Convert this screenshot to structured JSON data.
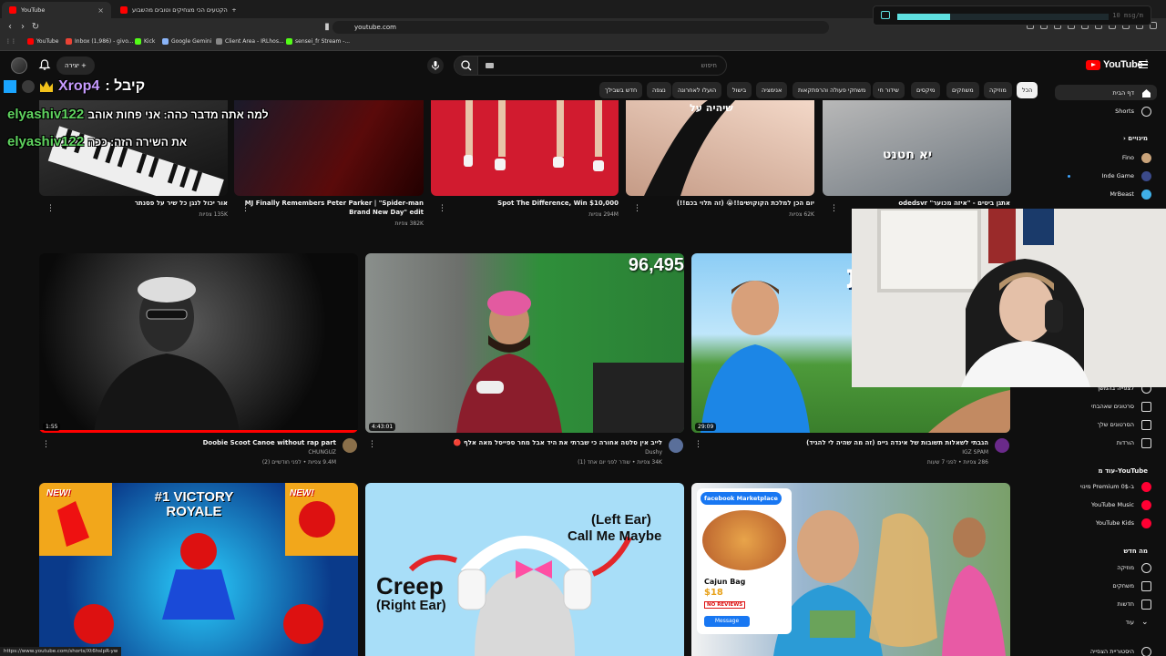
{
  "browser": {
    "tabs": [
      {
        "label": "YouTube",
        "active": true
      },
      {
        "label": "הקטעים הכי מצחיקים וטובים מהשבוע",
        "active": false
      }
    ],
    "url": "youtube.com",
    "bookmarks": [
      "YouTube",
      "Inbox (1,986) - givo...",
      "Kick",
      "Google Gemini",
      "Client Area - IRLhos...",
      "sensei_fr Stream -..."
    ],
    "overlay_reading": "10 msg/m",
    "overlay_level": 0.25,
    "status_url": "https://www.youtube.com/shorts/Xt6hslpR-yw"
  },
  "masthead": {
    "create_label": "יצירה",
    "search_placeholder": "חיפוש",
    "logo_text": "YouTube",
    "logo_country": "IL"
  },
  "chips": [
    "הכל",
    "מוזיקה",
    "משחקים",
    "מיקסים",
    "שידור חי",
    "משחקי פעולה והרפתקאות",
    "אנימציה",
    "בישול",
    "הועלו לאחרונה",
    "נצפה",
    "חדש בשבילך"
  ],
  "sidebar": {
    "main": [
      {
        "label": "דף הבית",
        "icon": "home-icon"
      },
      {
        "label": "Shorts",
        "icon": "shorts-icon"
      }
    ],
    "subs_header": "מינויים",
    "subs": [
      {
        "label": "Fino"
      },
      {
        "label": "Inde Game"
      },
      {
        "label": "MrBeast"
      }
    ],
    "you": [
      {
        "label": "לצפייה בהמשך",
        "icon": "watch-later-icon"
      },
      {
        "label": "סרטונים שאהבתי",
        "icon": "like-icon"
      },
      {
        "label": "הסרטונים שלך",
        "icon": "your-videos-icon"
      },
      {
        "label": "הורדות",
        "icon": "download-icon"
      }
    ],
    "more_header": "עוד מ-YouTube",
    "more": [
      {
        "label": "מינוי Premium ב-0$",
        "icon": "premium-icon"
      },
      {
        "label": "YouTube Music",
        "icon": "music-icon"
      },
      {
        "label": "YouTube Kids",
        "icon": "kids-icon"
      }
    ],
    "explore_header": "מה חדש",
    "explore": [
      {
        "label": "מוזיקה",
        "icon": "music-note-icon"
      },
      {
        "label": "משחקים",
        "icon": "gaming-icon"
      },
      {
        "label": "חדשות",
        "icon": "news-icon"
      },
      {
        "label": "עוד",
        "icon": "chevron-down-icon"
      }
    ],
    "history_label": "היסטוריית הצפייה"
  },
  "row1": [
    {
      "title": "אור יכול לנגן כל שיר על פסנתר",
      "meta": "135K צפיות"
    },
    {
      "title": "MJ Finally Remembers Peter Parker | \"Spider-man",
      "title2": "Brand New Day\" edit",
      "meta": "382K צפיות"
    },
    {
      "title": "Spot The Difference, Win $10,000",
      "meta": "294M צפיות"
    },
    {
      "title": "יום הכן למלכת הקוקושים!!😭 (זה תלוי בכם!!)",
      "meta": "62K צפיות"
    },
    {
      "title": "אתגן ביטים - \"איזה מכוער\" odedsvr",
      "meta": ""
    }
  ],
  "row2": [
    {
      "title": "Doobie Scoot Canoe without rap part",
      "channel": "CHUNGUZ",
      "meta": "9.4M צפיות • לפני חודשיים (2)",
      "duration": "1:55"
    },
    {
      "title": "לייב אין סלטה אחורה כי שברתי את היד אבל מחר ספייסל מאה אלף 🔴",
      "channel": "Dushy",
      "meta": "34K צפיות • שודר לפני יום אחד (1)",
      "duration": "4:43:01",
      "counter": "96,495"
    },
    {
      "title": "הגבתי לשאלות תשובות של אינדה גיים (זה מה שהיה לי להגיד)",
      "channel": "IGZ SPAM",
      "meta": "286 צפיות • לפני 7 שעות",
      "duration": "29:09",
      "thumb_text": "אלות שובות"
    }
  ],
  "row3": [
    {
      "thumb_title": "#1 VICTORY ROYALE",
      "badge": "NEW!"
    },
    {
      "thumb_left": "Creep",
      "thumb_left2": "(Right Ear)",
      "thumb_right": "(Left Ear)",
      "thumb_right2": "Call Me Maybe"
    },
    {
      "fb_label": "facebook Marketplace",
      "item": "Cajun Bag",
      "price": "$18",
      "no_reviews": "NO REVIEWS",
      "message": "Message"
    }
  ],
  "row1_thumb_text": {
    "t5": "יא חטנט",
    "t4": "שיהיה על"
  },
  "stream": {
    "tip_user": "Xrop4",
    "tip_label": ": קיבל",
    "messages": [
      {
        "user": "elyashiv122",
        "text": "למה אתה מדבר כהה: אני פחות אוהב"
      },
      {
        "user": "elyashiv122",
        "text": "את השירה הזה: ככה"
      }
    ]
  }
}
